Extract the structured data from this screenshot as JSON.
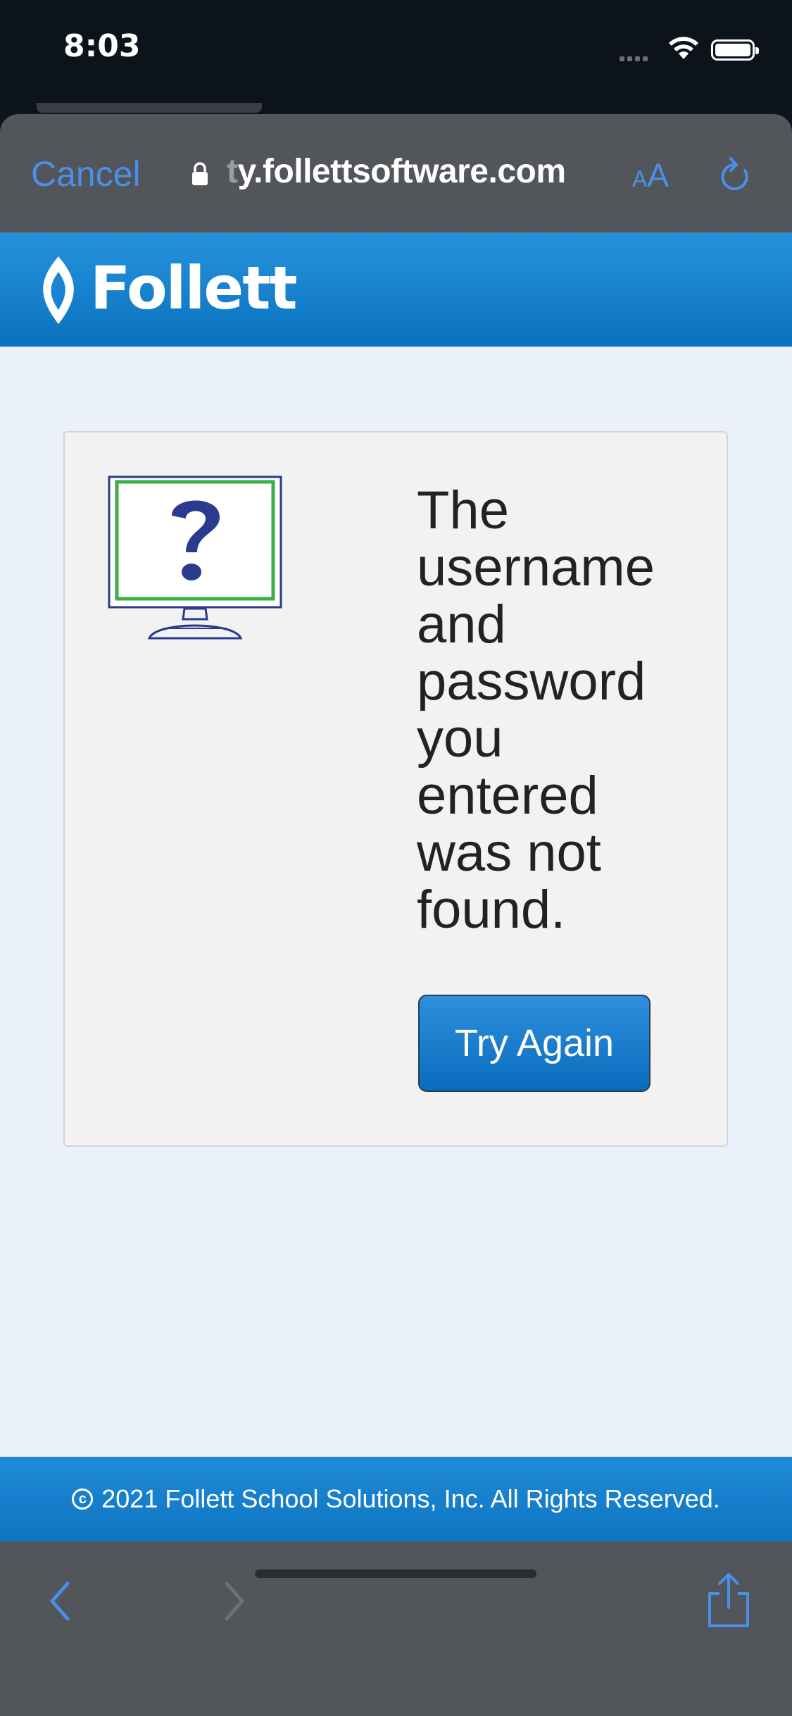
{
  "status_bar": {
    "time": "8:03"
  },
  "browser": {
    "cancel_label": "Cancel",
    "url_faded": "t",
    "url_main": "y.follettsoftware.com",
    "aa_small": "A",
    "aa_large": "A"
  },
  "brand": {
    "logo_text": "Follett",
    "color": "#1a84d2"
  },
  "error_card": {
    "message": "The username and password you entered was not found.",
    "try_again_label": "Try Again",
    "illustration_icon": "computer-question-icon"
  },
  "footer": {
    "copyright_symbol": "c",
    "text": "2021 Follett School Solutions, Inc. All Rights Reserved."
  },
  "toolbar": {
    "back_icon": "chevron-left-icon",
    "forward_icon": "chevron-right-icon",
    "share_icon": "share-icon"
  },
  "colors": {
    "accent": "#4a90e8",
    "chrome": "#525559",
    "page_bg": "#eaf1fa"
  }
}
